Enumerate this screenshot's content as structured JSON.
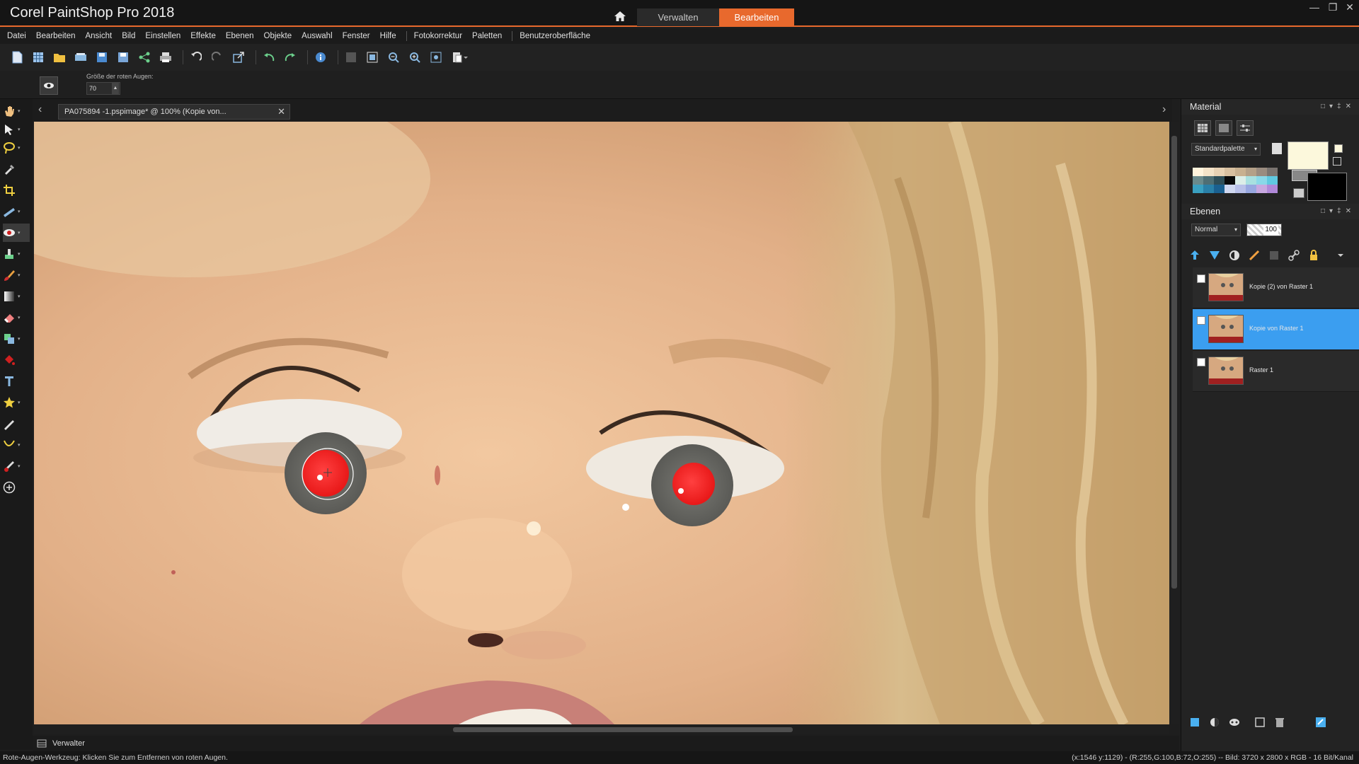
{
  "app": {
    "title": "Corel PaintShop Pro 2018",
    "modes": [
      "Verwalten",
      "Bearbeiten"
    ],
    "active_mode": "Bearbeiten",
    "accent": "#e8692d"
  },
  "menu": [
    "Datei",
    "Bearbeiten",
    "Ansicht",
    "Bild",
    "Einstellen",
    "Effekte",
    "Ebenen",
    "Objekte",
    "Auswahl",
    "Fenster",
    "Hilfe",
    "Fotokorrektur",
    "Paletten",
    "Benutzeroberfläche"
  ],
  "options": {
    "label": "Größe der roten Augen:",
    "value": "70"
  },
  "document": {
    "tab_title": "PA075894 -1.pspimage* @ 100% (Kopie von..."
  },
  "bottom": {
    "verwalter_label": "Verwalter"
  },
  "status": {
    "hint": "Rote-Augen-Werkzeug: Klicken Sie zum Entfernen von roten Augen.",
    "info": "(x:1546 y:1129) - (R:255,G:100,B:72,O:255) -- Bild:  3720 x 2800 x RGB - 16 Bit/Kanal"
  },
  "material": {
    "title": "Material",
    "palette_select": "Standardpalette",
    "fg_color": "#fcf8dc",
    "bg_color": "#000000",
    "swatches": [
      "#fff3dc",
      "#f4e3c8",
      "#e8d2b4",
      "#d8c0a0",
      "#c8b090",
      "#b4a088",
      "#9a8c80",
      "#7a7470",
      "#6a8a8c",
      "#4e6e74",
      "#2e4e58",
      "#0a0a0a",
      "#dceee8",
      "#a8e0e0",
      "#8ad8e8",
      "#60c8e0",
      "#3aa0c0",
      "#2a80a8",
      "#1a6090",
      "#d0d8f0",
      "#b8c0e8",
      "#98a8e0",
      "#c8a8e0",
      "#b088d8"
    ]
  },
  "layers": {
    "title": "Ebenen",
    "blend_mode": "Normal",
    "opacity": "100",
    "items": [
      {
        "name": "Kopie (2) von Raster 1",
        "selected": false
      },
      {
        "name": "Kopie von Raster 1",
        "selected": true
      },
      {
        "name": "Raster 1",
        "selected": false
      }
    ],
    "selection_color": "#3b9ef0"
  }
}
